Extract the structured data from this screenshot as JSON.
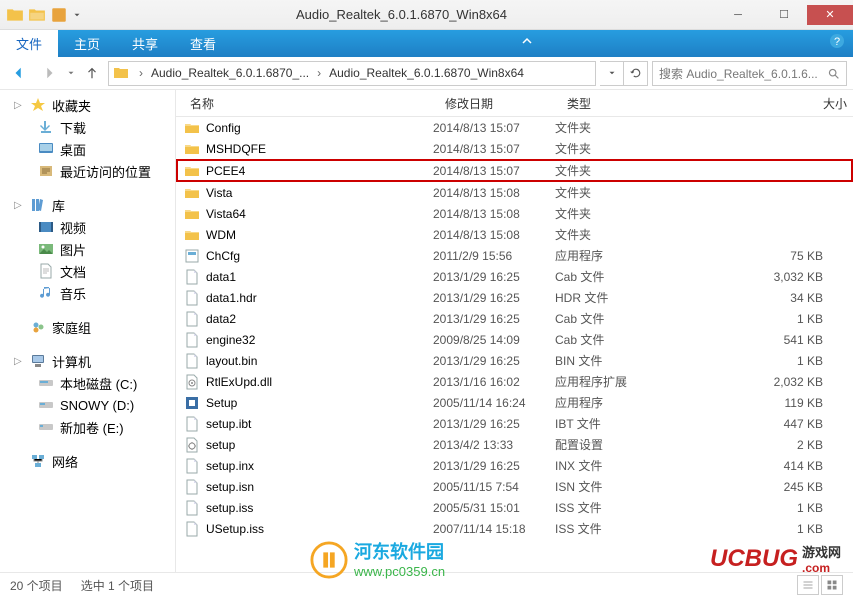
{
  "window": {
    "title": "Audio_Realtek_6.0.1.6870_Win8x64"
  },
  "menu": {
    "file": "文件",
    "home": "主页",
    "share": "共享",
    "view": "查看"
  },
  "breadcrumb": {
    "seg1": "Audio_Realtek_6.0.1.6870_...",
    "seg2": "Audio_Realtek_6.0.1.6870_Win8x64"
  },
  "search": {
    "placeholder": "搜索 Audio_Realtek_6.0.1.6..."
  },
  "sidebar": {
    "favorites": {
      "label": "收藏夹",
      "items": [
        "下载",
        "桌面",
        "最近访问的位置"
      ]
    },
    "libraries": {
      "label": "库",
      "items": [
        "视频",
        "图片",
        "文档",
        "音乐"
      ]
    },
    "homegroup": {
      "label": "家庭组"
    },
    "computer": {
      "label": "计算机",
      "items": [
        "本地磁盘 (C:)",
        "SNOWY (D:)",
        "新加卷 (E:)"
      ]
    },
    "network": {
      "label": "网络"
    }
  },
  "columns": {
    "name": "名称",
    "date": "修改日期",
    "type": "类型",
    "size": "大小"
  },
  "files": [
    {
      "icon": "folder",
      "name": "Config",
      "date": "2014/8/13 15:07",
      "type": "文件夹",
      "size": ""
    },
    {
      "icon": "folder",
      "name": "MSHDQFE",
      "date": "2014/8/13 15:07",
      "type": "文件夹",
      "size": ""
    },
    {
      "icon": "folder",
      "name": "PCEE4",
      "date": "2014/8/13 15:07",
      "type": "文件夹",
      "size": "",
      "highlighted": true
    },
    {
      "icon": "folder",
      "name": "Vista",
      "date": "2014/8/13 15:08",
      "type": "文件夹",
      "size": ""
    },
    {
      "icon": "folder",
      "name": "Vista64",
      "date": "2014/8/13 15:08",
      "type": "文件夹",
      "size": ""
    },
    {
      "icon": "folder",
      "name": "WDM",
      "date": "2014/8/13 15:08",
      "type": "文件夹",
      "size": ""
    },
    {
      "icon": "exe",
      "name": "ChCfg",
      "date": "2011/2/9 15:56",
      "type": "应用程序",
      "size": "75 KB"
    },
    {
      "icon": "file",
      "name": "data1",
      "date": "2013/1/29 16:25",
      "type": "Cab 文件",
      "size": "3,032 KB"
    },
    {
      "icon": "file",
      "name": "data1.hdr",
      "date": "2013/1/29 16:25",
      "type": "HDR 文件",
      "size": "34 KB"
    },
    {
      "icon": "file",
      "name": "data2",
      "date": "2013/1/29 16:25",
      "type": "Cab 文件",
      "size": "1 KB"
    },
    {
      "icon": "file",
      "name": "engine32",
      "date": "2009/8/25 14:09",
      "type": "Cab 文件",
      "size": "541 KB"
    },
    {
      "icon": "file",
      "name": "layout.bin",
      "date": "2013/1/29 16:25",
      "type": "BIN 文件",
      "size": "1 KB"
    },
    {
      "icon": "dll",
      "name": "RtlExUpd.dll",
      "date": "2013/1/16 16:02",
      "type": "应用程序扩展",
      "size": "2,032 KB"
    },
    {
      "icon": "setup",
      "name": "Setup",
      "date": "2005/11/14 16:24",
      "type": "应用程序",
      "size": "119 KB"
    },
    {
      "icon": "file",
      "name": "setup.ibt",
      "date": "2013/1/29 16:25",
      "type": "IBT 文件",
      "size": "447 KB"
    },
    {
      "icon": "ini",
      "name": "setup",
      "date": "2013/4/2 13:33",
      "type": "配置设置",
      "size": "2 KB"
    },
    {
      "icon": "file",
      "name": "setup.inx",
      "date": "2013/1/29 16:25",
      "type": "INX 文件",
      "size": "414 KB"
    },
    {
      "icon": "file",
      "name": "setup.isn",
      "date": "2005/11/15 7:54",
      "type": "ISN 文件",
      "size": "245 KB"
    },
    {
      "icon": "file",
      "name": "setup.iss",
      "date": "2005/5/31 15:01",
      "type": "ISS 文件",
      "size": "1 KB"
    },
    {
      "icon": "file",
      "name": "USetup.iss",
      "date": "2007/11/14 15:18",
      "type": "ISS 文件",
      "size": "1 KB"
    }
  ],
  "status": {
    "items": "20 个项目",
    "selected": "选中 1 个项目"
  },
  "watermark1": {
    "text": "河东软件园",
    "url": "www.pc0359.cn"
  },
  "watermark2": {
    "text": "UCBUG",
    "sub": "游戏网",
    "dom": ".com"
  }
}
